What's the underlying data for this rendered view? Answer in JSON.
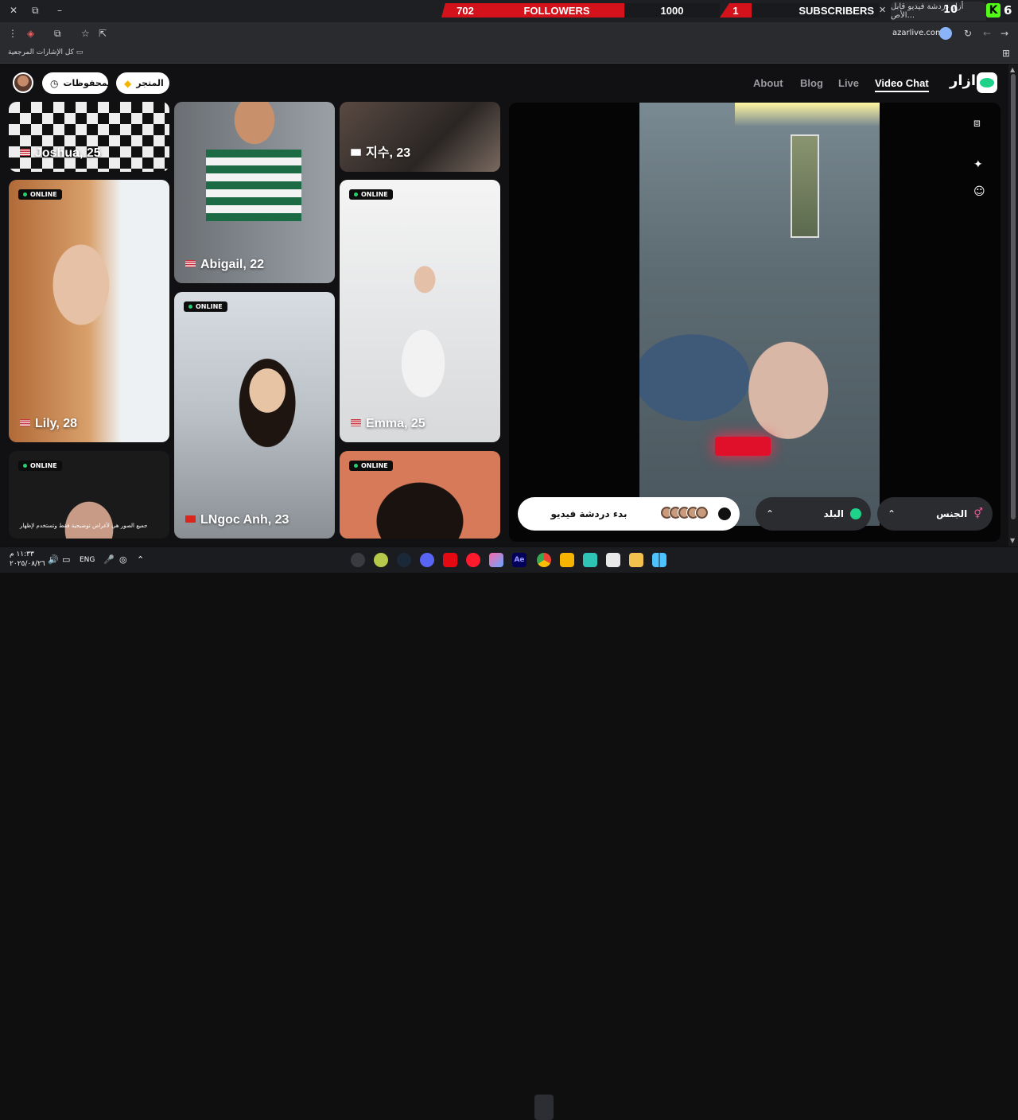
{
  "window": {
    "restore_icon": "⧉",
    "minimize_icon": "–",
    "close_icon": "✕"
  },
  "stream_overlay": {
    "followers_count": "702",
    "followers_label": "FOLLOWERS",
    "subscribers_goal": "1000",
    "subscribers_count": "1",
    "subscribers_label": "SUBSCRIBERS"
  },
  "tab": {
    "title": "أزار دردشة فيديو قابل الأص...",
    "number": "10",
    "count": "6"
  },
  "address": {
    "url": "azarlive.com"
  },
  "bookmarks": {
    "all_bookmarks": "كل الإشارات المرجعية"
  },
  "header": {
    "saved": "المحفوظات",
    "store": "المتجر",
    "nav": [
      "About",
      "Blog",
      "Live",
      "Video Chat"
    ],
    "brand": "ازار"
  },
  "cards": [
    {
      "name": "Joshua, 25"
    },
    {
      "name": "Abigail, 22"
    },
    {
      "name": "지수, 23"
    },
    {
      "name": "Lily, 28",
      "status": "ONLINE"
    },
    {
      "name": "Emma, 25",
      "status": "ONLINE"
    },
    {
      "name": "LNgoc Anh, 23",
      "status": "ONLINE"
    },
    {
      "status": "ONLINE",
      "caption": "جميع الصور هي لأغراض توضيحية فقط وتستخدم لإظهار"
    },
    {
      "status": "ONLINE"
    }
  ],
  "controls": {
    "start_video_chat": "بدء دردشة فيديو",
    "country": "البلد",
    "gender": "الجنس"
  },
  "taskbar": {
    "time": "١١:٣٣ م",
    "date": "٢٠٢٥/٠٨/٢٦",
    "lang": "ENG"
  }
}
